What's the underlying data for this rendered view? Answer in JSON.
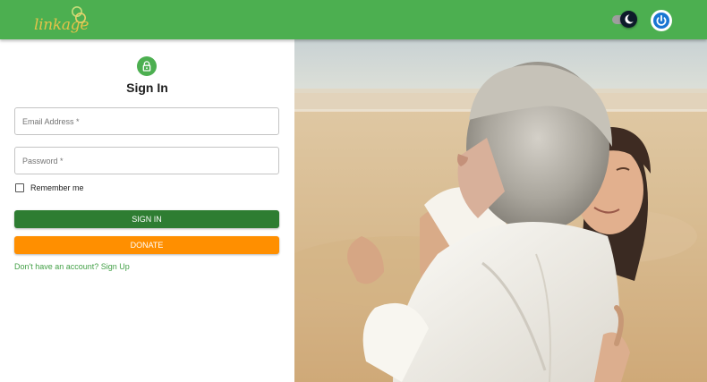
{
  "header": {
    "logo_text": "linkage",
    "bar_color": "#4caf50",
    "icons": [
      "theme-toggle-icon",
      "power-icon"
    ]
  },
  "signin": {
    "title": "Sign In",
    "icon": "lock-icon",
    "email_placeholder": "Email Address *",
    "email_value": "",
    "password_placeholder": "Password *",
    "password_value": "",
    "remember_label": "Remember me",
    "remember_checked": false,
    "signin_button": "Sign In",
    "donate_button": "Donate",
    "signup_link": "Don't have an account? Sign Up"
  },
  "colors": {
    "primary": "#4caf50",
    "signin_button": "#2e7d32",
    "donate_button": "#ff8f00",
    "link": "#43a047"
  },
  "hero": {
    "icon": "hero-photo"
  }
}
